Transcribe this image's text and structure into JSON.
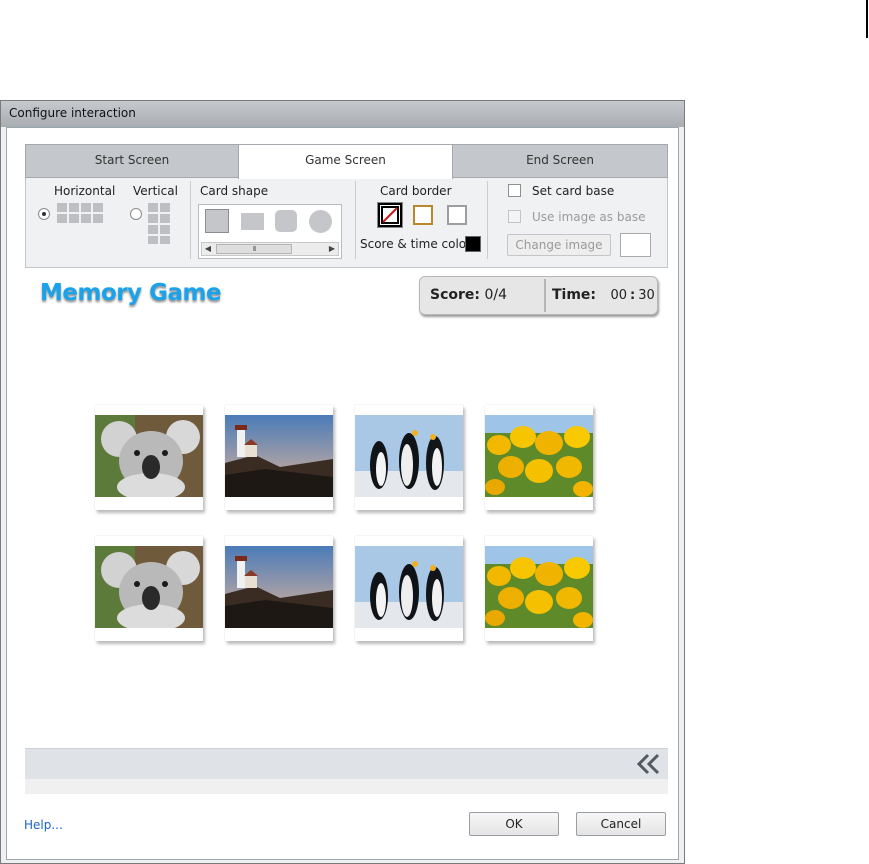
{
  "window": {
    "title": "Configure interaction"
  },
  "tabs": [
    {
      "label": "Start Screen",
      "active": false
    },
    {
      "label": "Game Screen",
      "active": true
    },
    {
      "label": "End Screen",
      "active": false
    }
  ],
  "toolbar": {
    "orientation": {
      "horizontal_label": "Horizontal",
      "vertical_label": "Vertical",
      "selected": "horizontal"
    },
    "card_shape": {
      "label": "Card shape",
      "options": [
        "square",
        "rectangle",
        "rounded-square",
        "circle"
      ],
      "selected": "square",
      "scroll_thumb": "III"
    },
    "card_border": {
      "label": "Card border",
      "options": [
        {
          "name": "no-border",
          "color": "#000000"
        },
        {
          "name": "gold-border",
          "color": "#b8862b"
        },
        {
          "name": "gray-border",
          "color": "#9e9e9e"
        }
      ],
      "selected": "no-border"
    },
    "score_time_color": {
      "label": "Score & time color",
      "color": "#000000"
    },
    "set_card_base": {
      "label": "Set card base",
      "checked": false
    },
    "use_image_as_base": {
      "label": "Use image as base",
      "checked": false,
      "enabled": false
    },
    "change_image": {
      "label": "Change image",
      "enabled": false
    }
  },
  "game": {
    "title": "Memory Game",
    "score_label": "Score:",
    "score_value": "0/4",
    "time_label": "Time:",
    "time_minutes": "00",
    "time_sep": ":",
    "time_seconds": "30",
    "cards": [
      {
        "image": "koala"
      },
      {
        "image": "lighthouse"
      },
      {
        "image": "penguins"
      },
      {
        "image": "tulips"
      },
      {
        "image": "koala"
      },
      {
        "image": "lighthouse"
      },
      {
        "image": "penguins"
      },
      {
        "image": "tulips"
      }
    ]
  },
  "footer": {
    "help_label": "Help...",
    "ok_label": "OK",
    "cancel_label": "Cancel"
  },
  "icons": {
    "collapse": "double-chevron-left-icon"
  },
  "colors": {
    "accent": "#1aa3ea",
    "link": "#1a66cc"
  }
}
